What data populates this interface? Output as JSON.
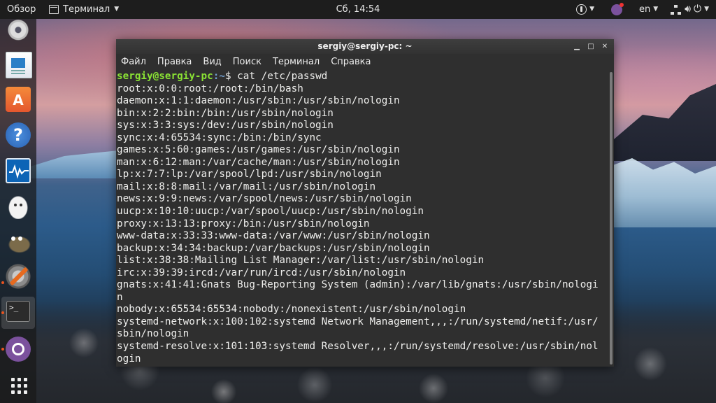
{
  "topbar": {
    "activities": "Обзор",
    "app_menu": "Терминал",
    "clock": "Сб, 14:54",
    "language": "en"
  },
  "dock": {
    "items": [
      "disk-app",
      "writer",
      "software-center",
      "help",
      "system-monitor",
      "egg-app",
      "gimp",
      "settings",
      "terminal",
      "viber",
      "show-apps"
    ],
    "terminal_glyph": ">_"
  },
  "terminal": {
    "title": "sergiy@sergiy-pc: ~",
    "menu": [
      "Файл",
      "Правка",
      "Вид",
      "Поиск",
      "Терминал",
      "Справка"
    ],
    "prompt": {
      "user_host": "sergiy@sergiy-pc",
      "path": ":~",
      "symbol": "$ ",
      "command": "cat /etc/passwd"
    },
    "output": [
      "root:x:0:0:root:/root:/bin/bash",
      "daemon:x:1:1:daemon:/usr/sbin:/usr/sbin/nologin",
      "bin:x:2:2:bin:/bin:/usr/sbin/nologin",
      "sys:x:3:3:sys:/dev:/usr/sbin/nologin",
      "sync:x:4:65534:sync:/bin:/bin/sync",
      "games:x:5:60:games:/usr/games:/usr/sbin/nologin",
      "man:x:6:12:man:/var/cache/man:/usr/sbin/nologin",
      "lp:x:7:7:lp:/var/spool/lpd:/usr/sbin/nologin",
      "mail:x:8:8:mail:/var/mail:/usr/sbin/nologin",
      "news:x:9:9:news:/var/spool/news:/usr/sbin/nologin",
      "uucp:x:10:10:uucp:/var/spool/uucp:/usr/sbin/nologin",
      "proxy:x:13:13:proxy:/bin:/usr/sbin/nologin",
      "www-data:x:33:33:www-data:/var/www:/usr/sbin/nologin",
      "backup:x:34:34:backup:/var/backups:/usr/sbin/nologin",
      "list:x:38:38:Mailing List Manager:/var/list:/usr/sbin/nologin",
      "irc:x:39:39:ircd:/var/run/ircd:/usr/sbin/nologin",
      "gnats:x:41:41:Gnats Bug-Reporting System (admin):/var/lib/gnats:/usr/sbin/nologi",
      "n",
      "nobody:x:65534:65534:nobody:/nonexistent:/usr/sbin/nologin",
      "systemd-network:x:100:102:systemd Network Management,,,:/run/systemd/netif:/usr/",
      "sbin/nologin",
      "systemd-resolve:x:101:103:systemd Resolver,,,:/run/systemd/resolve:/usr/sbin/nol",
      "ogin"
    ]
  },
  "colors": {
    "prompt_user": "#8ae234",
    "prompt_path": "#729fcf",
    "terminal_bg": "#2f2f2f",
    "terminal_fg": "#eeeeec",
    "topbar_bg": "#1d1d1d",
    "dock_indicator": "#e95420"
  }
}
